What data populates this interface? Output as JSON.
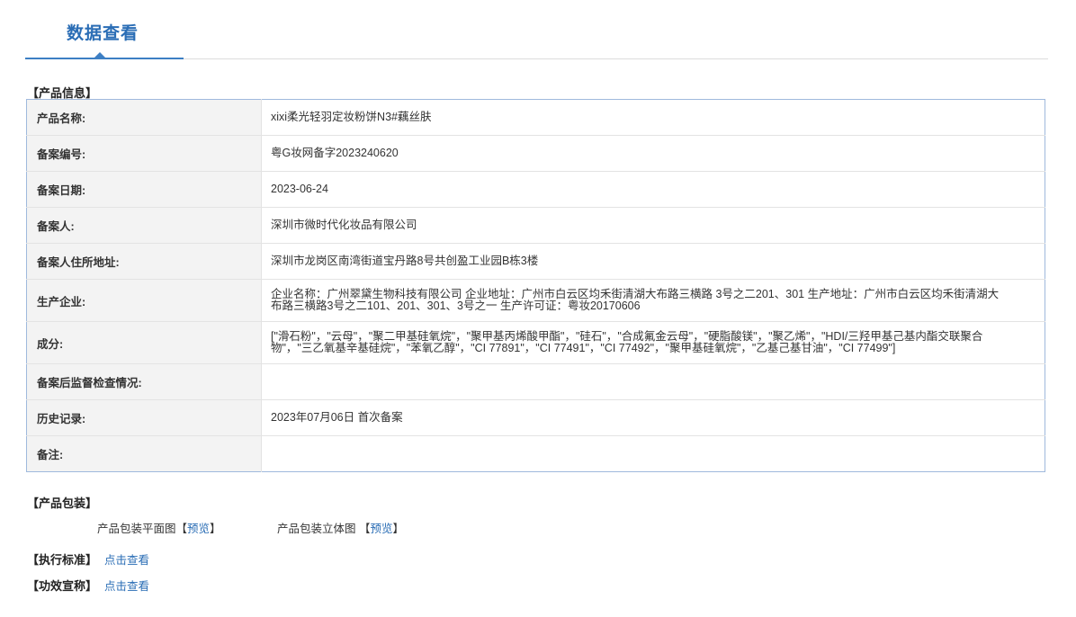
{
  "header": {
    "title": "数据查看"
  },
  "product_info": {
    "section_label": "【产品信息】",
    "rows": [
      {
        "key": "产品名称:",
        "value": "xixi柔光轻羽定妆粉饼N3#藕丝肤"
      },
      {
        "key": "备案编号:",
        "value": "粤G妆网备字2023240620"
      },
      {
        "key": "备案日期:",
        "value": "2023-06-24"
      },
      {
        "key": "备案人:",
        "value": "深圳市微时代化妆品有限公司"
      },
      {
        "key": "备案人住所地址:",
        "value": "深圳市龙岗区南湾街道宝丹路8号共创盈工业园B栋3楼"
      },
      {
        "key": "生产企业:",
        "value": "企业名称：广州翠黛生物科技有限公司 企业地址：广州市白云区均禾街清湖大布路三横路 3号之二201、301 生产地址：广州市白云区均禾街清湖大布路三横路3号之二101、201、301、3号之一 生产许可证：粤妆20170606"
      },
      {
        "key": "成分:",
        "value": "[\"滑石粉\"，\"云母\"，\"聚二甲基硅氧烷\"，\"聚甲基丙烯酸甲酯\"，\"硅石\"，\"合成氟金云母\"，\"硬脂酸镁\"，\"聚乙烯\"，\"HDI/三羟甲基己基内酯交联聚合物\"，\"三乙氧基辛基硅烷\"，\"苯氧乙醇\"，\"CI 77891\"，\"CI 77491\"，\"CI 77492\"，\"聚甲基硅氧烷\"，\"乙基己基甘油\"，\"CI 77499\"]"
      },
      {
        "key": "备案后监督检查情况:",
        "value": ""
      },
      {
        "key": "历史记录:",
        "value": "2023年07月06日 首次备案"
      },
      {
        "key": "备注:",
        "value": ""
      }
    ]
  },
  "packaging": {
    "section_label": "【产品包装】",
    "flat_label": "产品包装平面图",
    "stereo_label": "产品包装立体图",
    "bracket_open": "【",
    "bracket_close": "】",
    "preview_link": "预览"
  },
  "standard": {
    "label": "【执行标准】",
    "link": "点击查看"
  },
  "efficacy": {
    "label": "【功效宣称】",
    "link": "点击查看"
  }
}
